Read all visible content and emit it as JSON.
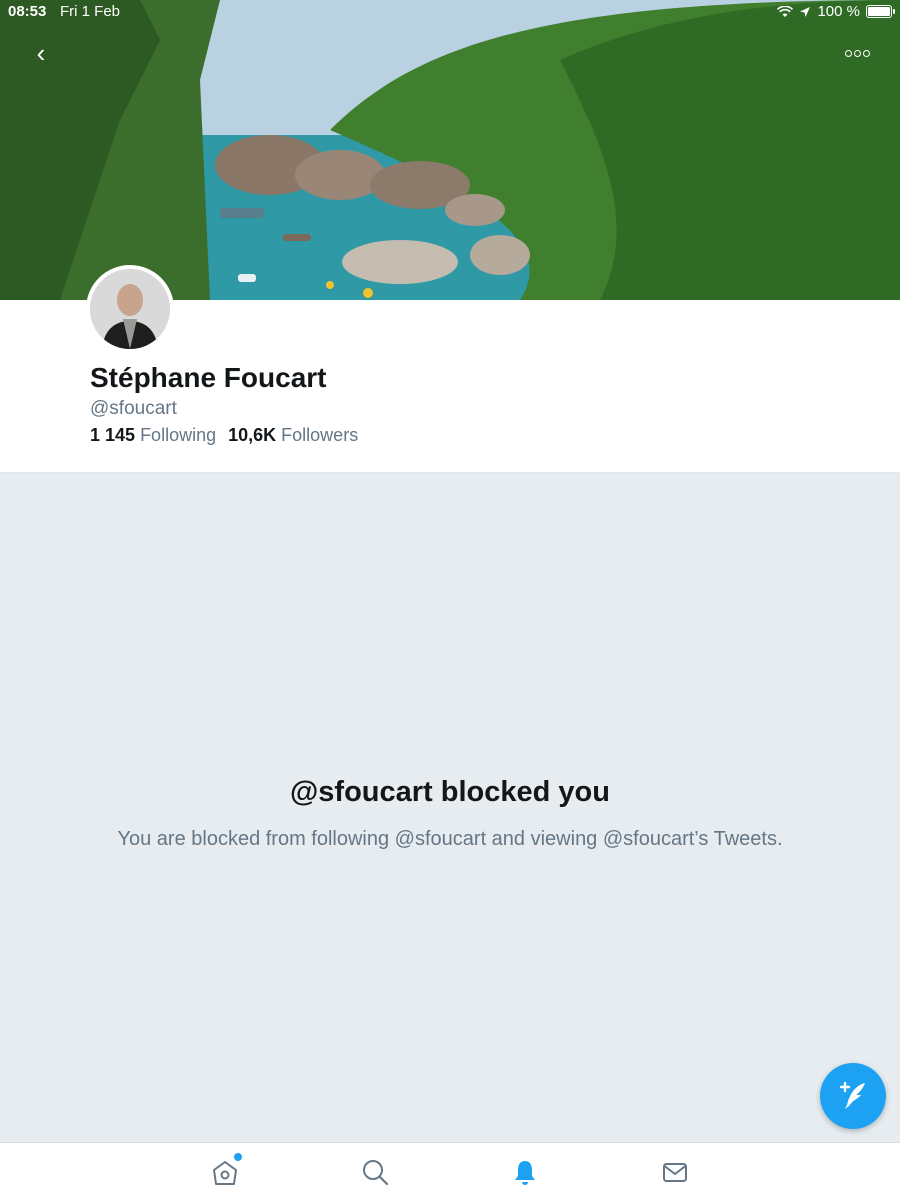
{
  "status_bar": {
    "time": "08:53",
    "date": "Fri 1 Feb",
    "battery": "100 %"
  },
  "profile": {
    "name": "Stéphane Foucart",
    "handle": "@sfoucart",
    "following_count": "1 145",
    "following_label": "Following",
    "followers_count": "10,6K",
    "followers_label": "Followers"
  },
  "blocked": {
    "title": "@sfoucart blocked you",
    "description": "You are blocked from following @sfoucart and viewing @sfoucart’s Tweets."
  },
  "tabbar": {
    "items": [
      {
        "icon": "home-icon",
        "has_notification_dot": true
      },
      {
        "icon": "search-icon"
      },
      {
        "icon": "bell-icon",
        "active": true
      },
      {
        "icon": "mail-icon"
      }
    ]
  },
  "colors": {
    "accent": "#1da1f2",
    "text_primary": "#14171a",
    "text_secondary": "#657786",
    "background": "#e6ecf0"
  },
  "icons": {
    "back": "chevron-left-icon",
    "more": "more-icon",
    "compose": "compose-tweet-icon"
  }
}
